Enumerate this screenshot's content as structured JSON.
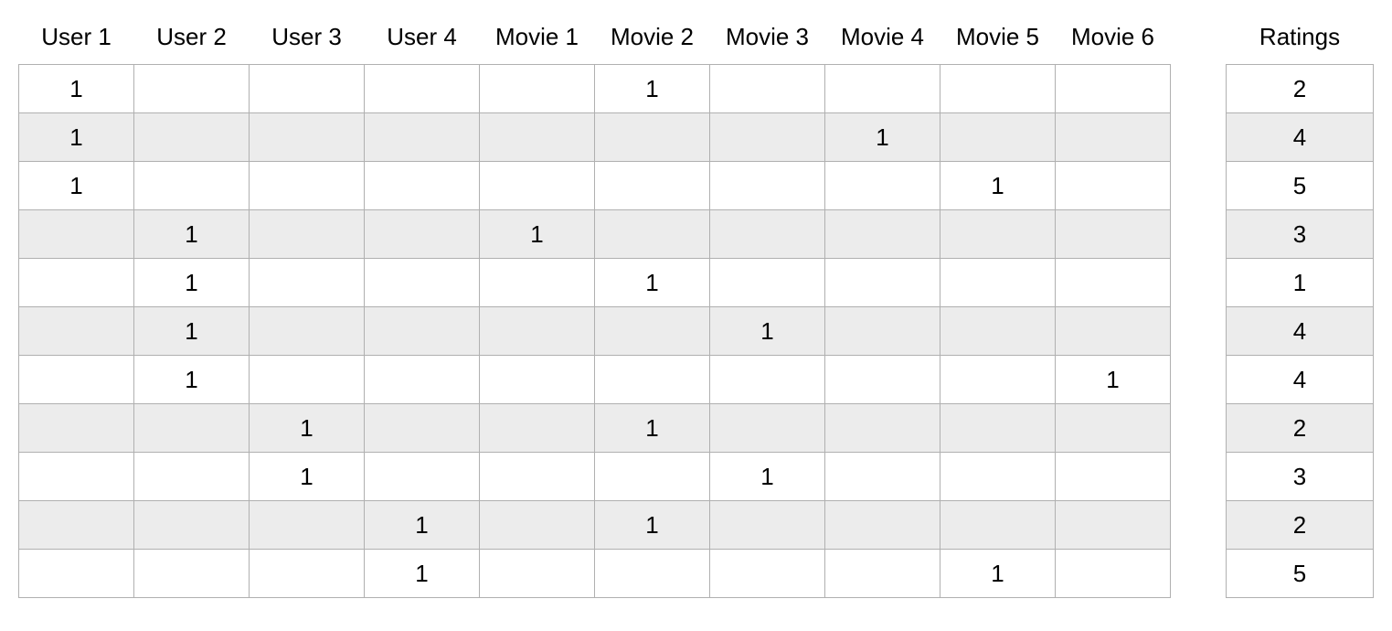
{
  "chart_data": {
    "type": "table",
    "main": {
      "headers": [
        "User 1",
        "User 2",
        "User 3",
        "User 4",
        "Movie 1",
        "Movie 2",
        "Movie 3",
        "Movie 4",
        "Movie 5",
        "Movie 6"
      ],
      "rows": [
        [
          "1",
          "",
          "",
          "",
          "",
          "1",
          "",
          "",
          "",
          ""
        ],
        [
          "1",
          "",
          "",
          "",
          "",
          "",
          "",
          "1",
          "",
          ""
        ],
        [
          "1",
          "",
          "",
          "",
          "",
          "",
          "",
          "",
          "1",
          ""
        ],
        [
          "",
          "1",
          "",
          "",
          "1",
          "",
          "",
          "",
          "",
          ""
        ],
        [
          "",
          "1",
          "",
          "",
          "",
          "1",
          "",
          "",
          "",
          ""
        ],
        [
          "",
          "1",
          "",
          "",
          "",
          "",
          "1",
          "",
          "",
          ""
        ],
        [
          "",
          "1",
          "",
          "",
          "",
          "",
          "",
          "",
          "",
          "1"
        ],
        [
          "",
          "",
          "1",
          "",
          "",
          "1",
          "",
          "",
          "",
          ""
        ],
        [
          "",
          "",
          "1",
          "",
          "",
          "",
          "1",
          "",
          "",
          ""
        ],
        [
          "",
          "",
          "",
          "1",
          "",
          "1",
          "",
          "",
          "",
          ""
        ],
        [
          "",
          "",
          "",
          "1",
          "",
          "",
          "",
          "",
          "1",
          ""
        ]
      ]
    },
    "ratings": {
      "header": "Ratings",
      "values": [
        "2",
        "4",
        "5",
        "3",
        "1",
        "4",
        "4",
        "2",
        "3",
        "2",
        "5"
      ]
    }
  }
}
